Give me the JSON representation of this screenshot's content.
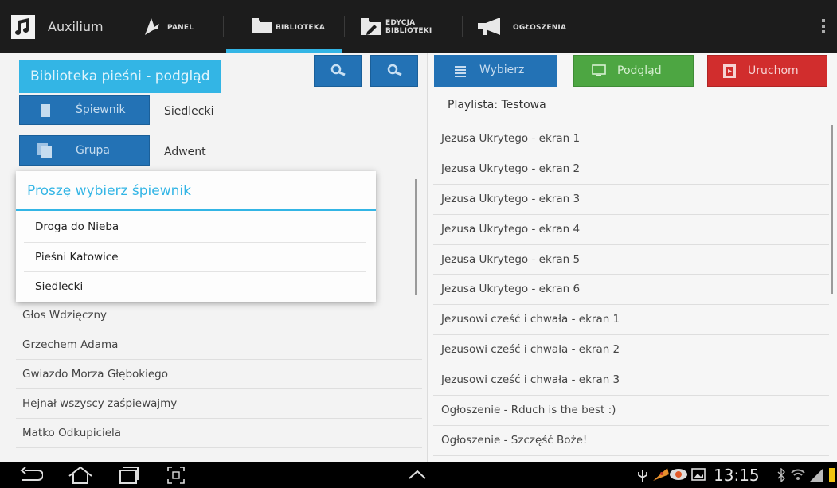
{
  "app": {
    "title": "Auxilium",
    "accent_color": "#33b5e5"
  },
  "nav_tabs": [
    {
      "label": "PANEL",
      "icon": "megaphone-small-icon"
    },
    {
      "label": "BIBLIOTEKA",
      "icon": "folder-icon",
      "active": true
    },
    {
      "label_line1": "EDYCJA",
      "label_line2": "BIBLIOTEKI",
      "icon": "edit-folder-icon"
    },
    {
      "label": "OGŁOSZENIA",
      "icon": "megaphone-icon"
    }
  ],
  "library": {
    "title": "Biblioteka pieśni - podgląd",
    "spiewnik_button": "Śpiewnik",
    "spiewnik_value": "Siedlecki",
    "grupa_button": "Grupa",
    "grupa_value": "Adwent",
    "songs": [
      "Głos Wdzięczny",
      "Grzechem Adama",
      "Gwiazdo Morza Głębokiego",
      "Hejnał wszyscy zaśpiewajmy",
      "Matko Odkupiciela"
    ]
  },
  "toolbar": {
    "wybierz": "Wybierz",
    "podglad": "Podgląd",
    "uruchom": "Uruchom",
    "colors": {
      "blue": "#2372b5",
      "green": "#4da642",
      "red": "#d12d2d"
    }
  },
  "playlist": {
    "title": "Playlista:  Testowa",
    "items": [
      "Jezusa Ukrytego - ekran 1",
      "Jezusa Ukrytego - ekran 2",
      "Jezusa Ukrytego - ekran 3",
      "Jezusa Ukrytego - ekran 4",
      "Jezusa Ukrytego - ekran 5",
      "Jezusa Ukrytego - ekran 6",
      "Jezusowi cześć i chwała - ekran 1",
      "Jezusowi cześć i chwała - ekran 2",
      "Jezusowi cześć i chwała - ekran 3",
      "Ogłoszenie - Rduch is the best :)",
      "Ogłoszenie - Szczęść Boże!"
    ]
  },
  "dialog": {
    "title": "Proszę wybierz śpiewnik",
    "options": [
      "Droga do Nieba",
      "Pieśni Katowice",
      "Siedlecki"
    ]
  },
  "system_bar": {
    "time": "13:15"
  }
}
